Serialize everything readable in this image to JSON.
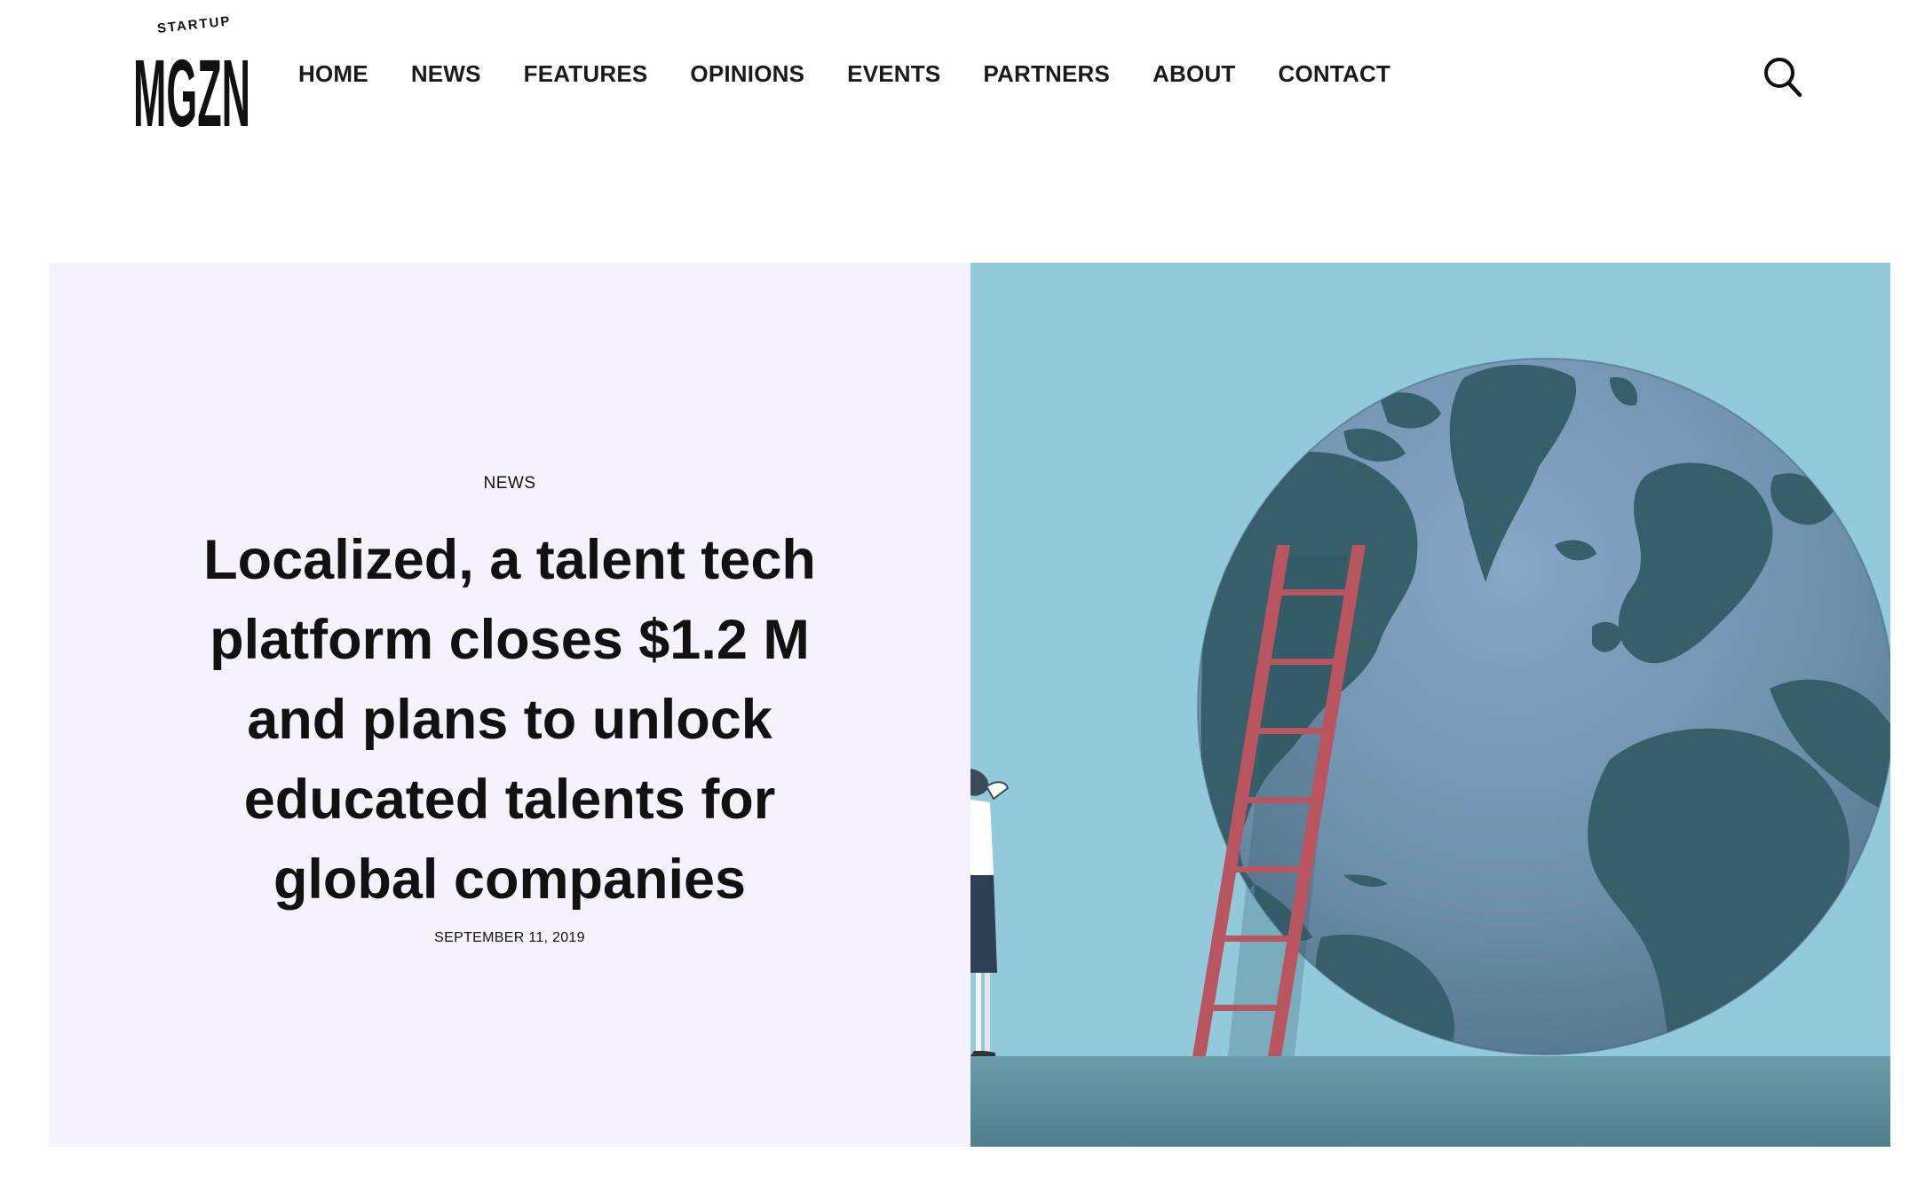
{
  "logo": {
    "small_text": "STARTUP",
    "big_text": "MGZN"
  },
  "nav": {
    "items": [
      {
        "label": "HOME"
      },
      {
        "label": "NEWS"
      },
      {
        "label": "FEATURES"
      },
      {
        "label": "OPINIONS"
      },
      {
        "label": "EVENTS"
      },
      {
        "label": "PARTNERS"
      },
      {
        "label": "ABOUT"
      },
      {
        "label": "CONTACT"
      }
    ],
    "search_icon": "search-icon"
  },
  "hero": {
    "category": "NEWS",
    "title": "Localized, a talent tech platform closes $1.2 M and plans to unlock educated talents for global companies",
    "date": "SEPTEMBER 11, 2019",
    "image_subject": "globe-with-ladder-illustration"
  },
  "colors": {
    "hero_text_bg": "#f5f2fd",
    "sky": "#92cadb",
    "ground": "#5b8c99",
    "globe_ocean": "#6f97b4",
    "globe_land": "#365f6b",
    "ladder": "#b8555f",
    "text": "#111111"
  }
}
